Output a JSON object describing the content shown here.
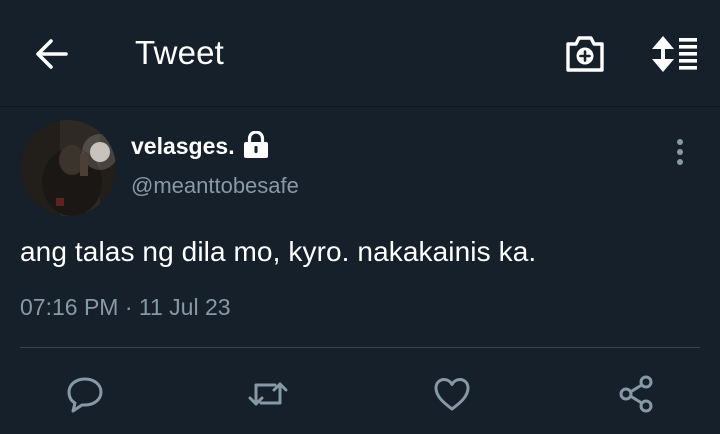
{
  "header": {
    "title": "Tweet",
    "back_icon": "arrow-left-icon",
    "camera_icon": "camera-plus-icon",
    "sort_icon": "sort-toggle-icon"
  },
  "tweet": {
    "display_name": "velasges.",
    "protected_icon": "lock-icon",
    "handle": "@meanttobesafe",
    "text": "ang talas ng dila mo, kyro. nakakainis ka.",
    "time": "07:16 PM",
    "separator": "·",
    "date": "11 Jul 23"
  },
  "actions": [
    {
      "name": "reply",
      "icon": "reply-icon"
    },
    {
      "name": "retweet",
      "icon": "retweet-icon"
    },
    {
      "name": "like",
      "icon": "heart-icon"
    },
    {
      "name": "share",
      "icon": "share-icon"
    }
  ],
  "colors": {
    "background": "#15202b",
    "text": "#ffffff",
    "secondary_text": "#8899a6",
    "divider": "#38444d"
  }
}
